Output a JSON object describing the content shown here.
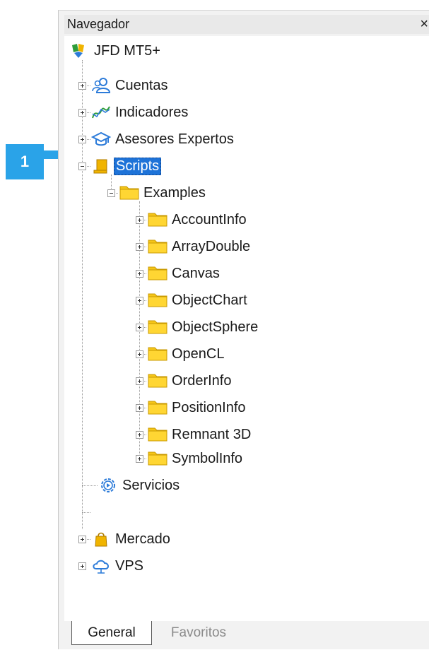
{
  "panel": {
    "title": "Navegador",
    "close_glyph": "×"
  },
  "tree": {
    "root": "JFD MT5+",
    "items": [
      {
        "label": "Cuentas",
        "icon": "accounts-icon"
      },
      {
        "label": "Indicadores",
        "icon": "indicators-icon"
      },
      {
        "label": "Asesores Expertos",
        "icon": "expert-advisors-icon"
      },
      {
        "label": "Scripts",
        "icon": "scripts-icon",
        "selected": true
      },
      {
        "label": "Examples",
        "icon": "folder-icon"
      },
      {
        "label": "AccountInfo",
        "icon": "folder-icon"
      },
      {
        "label": "ArrayDouble",
        "icon": "folder-icon"
      },
      {
        "label": "Canvas",
        "icon": "folder-icon"
      },
      {
        "label": "ObjectChart",
        "icon": "folder-icon"
      },
      {
        "label": "ObjectSphere",
        "icon": "folder-icon"
      },
      {
        "label": "OpenCL",
        "icon": "folder-icon"
      },
      {
        "label": "OrderInfo",
        "icon": "folder-icon"
      },
      {
        "label": "PositionInfo",
        "icon": "folder-icon"
      },
      {
        "label": "Remnant 3D",
        "icon": "folder-icon"
      },
      {
        "label": "SymbolInfo",
        "icon": "folder-icon"
      },
      {
        "label": "Servicios",
        "icon": "services-icon"
      },
      {
        "label": "Mercado",
        "icon": "market-icon"
      },
      {
        "label": "VPS",
        "icon": "vps-icon"
      }
    ]
  },
  "tabs": {
    "general": "General",
    "favorites": "Favoritos"
  },
  "callout": {
    "number": "1",
    "color": "#2aa3e8"
  },
  "colors": {
    "selection": "#1e73d8",
    "folder": "#f5c518"
  }
}
